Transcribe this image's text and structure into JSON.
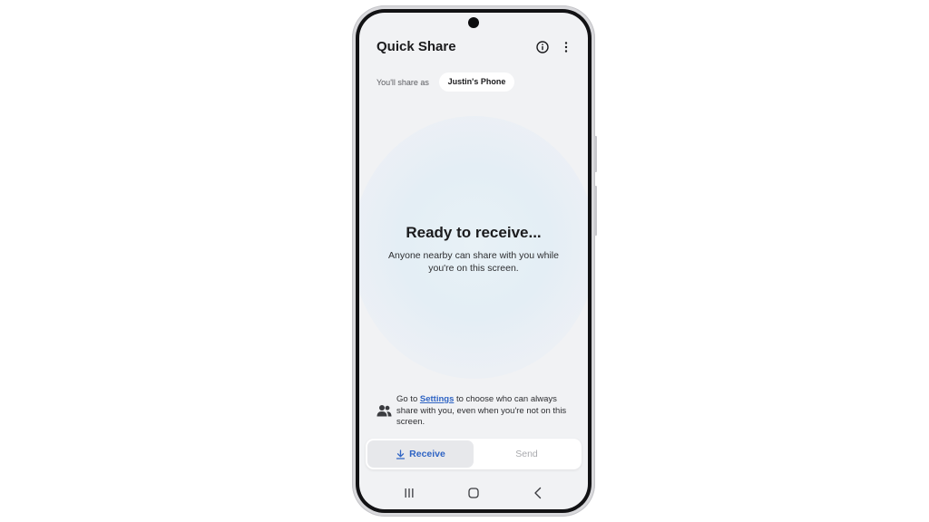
{
  "app": {
    "title": "Quick Share"
  },
  "identity": {
    "label": "You'll share as",
    "device_name": "Justin's Phone"
  },
  "status": {
    "heading": "Ready to receive...",
    "description": "Anyone nearby can share with you while you're on this screen."
  },
  "settings_note": {
    "prefix": "Go to ",
    "link": "Settings",
    "suffix": " to choose who can always share with you, even when you're not on this screen."
  },
  "tabs": {
    "receive": "Receive",
    "send": "Send",
    "selected": "receive"
  },
  "icons": {
    "info": "info-icon",
    "more": "more-vert-icon",
    "people": "people-icon",
    "download": "download-icon",
    "nav_recents": "recents-icon",
    "nav_home": "home-icon",
    "nav_back": "back-icon"
  },
  "colors": {
    "accent": "#2f64c4",
    "background": "#f1f2f4",
    "text": "#1b1b1d",
    "disabled_text": "#a9aaae"
  }
}
